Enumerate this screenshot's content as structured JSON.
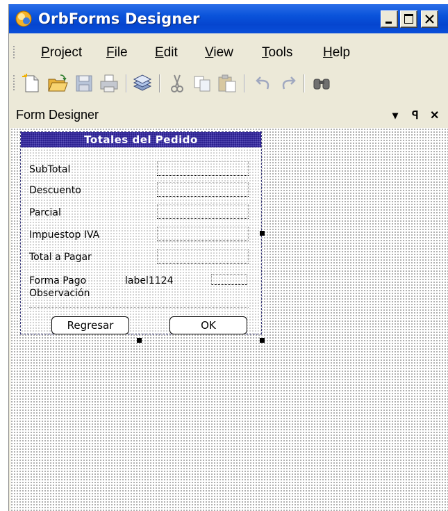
{
  "window": {
    "title": "OrbForms Designer"
  },
  "menu": {
    "items": [
      {
        "label": "Project",
        "accel": "P",
        "rest": "roject"
      },
      {
        "label": "File",
        "accel": "F",
        "rest": "ile"
      },
      {
        "label": "Edit",
        "accel": "E",
        "rest": "dit"
      },
      {
        "label": "View",
        "accel": "V",
        "rest": "iew"
      },
      {
        "label": "Tools",
        "accel": "T",
        "rest": "ools"
      },
      {
        "label": "Help",
        "accel": "H",
        "rest": "elp"
      }
    ]
  },
  "toolbar": {
    "icons": [
      "new-file-icon",
      "open-folder-icon",
      "save-icon",
      "print-icon",
      "layers-icon",
      "cut-icon",
      "copy-icon",
      "paste-icon",
      "undo-icon",
      "redo-icon",
      "find-icon"
    ]
  },
  "panel": {
    "title": "Form Designer",
    "dropdown_glyph": "▾",
    "pin_glyph": "ꟼ",
    "close_glyph": "✕"
  },
  "form": {
    "title": "Totales del Pedido",
    "labels": {
      "subtotal": "SubTotal",
      "descuento": "Descuento",
      "parcial": "Parcial",
      "impuesto": "Impuestop IVA",
      "total": "Total a Pagar",
      "forma_pago": "Forma Pago",
      "observacion": "Observación"
    },
    "forma_pago_value": "label1124",
    "buttons": {
      "regresar": "Regresar",
      "ok": "OK"
    }
  },
  "colors": {
    "titlebar": "#0a53da",
    "form_title": "#2a1f8f",
    "chrome": "#ece9d8"
  }
}
